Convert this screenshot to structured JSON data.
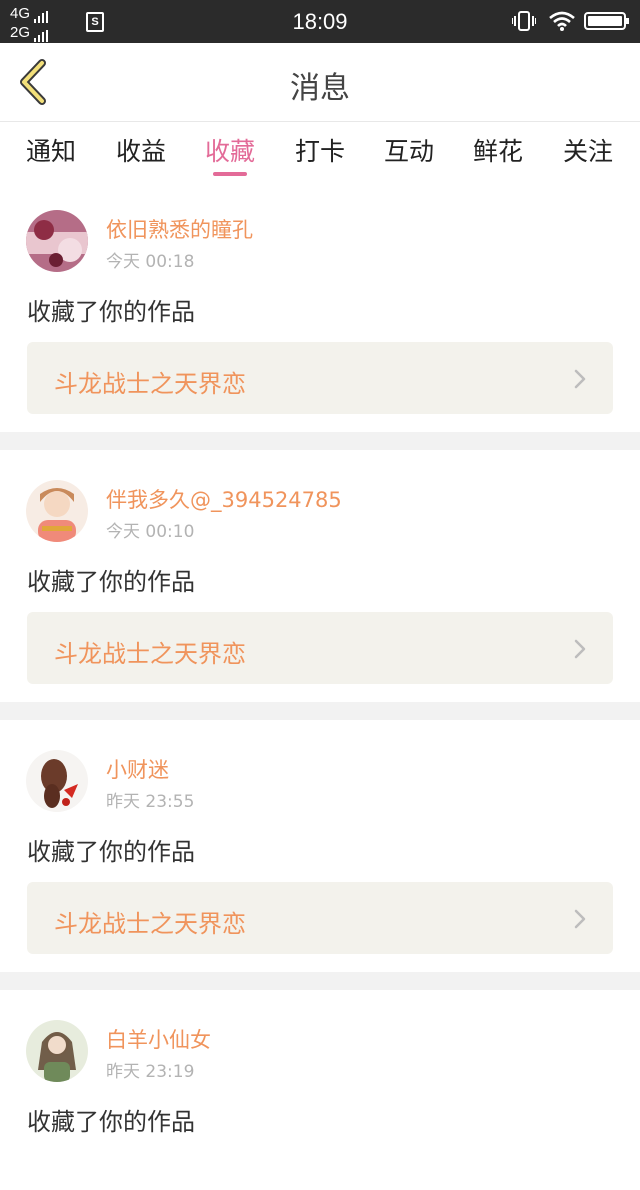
{
  "status_bar": {
    "net_top": "4G",
    "net_bottom": "2G",
    "sim_label": "S",
    "time": "18:09"
  },
  "header": {
    "title": "消息"
  },
  "tabs": [
    {
      "label": "通知"
    },
    {
      "label": "收益"
    },
    {
      "label": "收藏"
    },
    {
      "label": "打卡"
    },
    {
      "label": "互动"
    },
    {
      "label": "鲜花"
    },
    {
      "label": "关注"
    }
  ],
  "active_tab": "收藏",
  "colors": {
    "accent": "#e36b98",
    "username": "#f0945c",
    "work_bg": "#f3f2ec"
  },
  "notifications": [
    {
      "user": "依旧熟悉的瞳孔",
      "time": "今天 00:18",
      "action": "收藏了你的作品",
      "work": "斗龙战士之天界恋"
    },
    {
      "user": "伴我多久@_394524785",
      "time": "今天 00:10",
      "action": "收藏了你的作品",
      "work": "斗龙战士之天界恋"
    },
    {
      "user": "小财迷",
      "time": "昨天 23:55",
      "action": "收藏了你的作品",
      "work": "斗龙战士之天界恋"
    },
    {
      "user": "白羊小仙女",
      "time": "昨天 23:19",
      "action": "收藏了你的作品",
      "work": ""
    }
  ]
}
